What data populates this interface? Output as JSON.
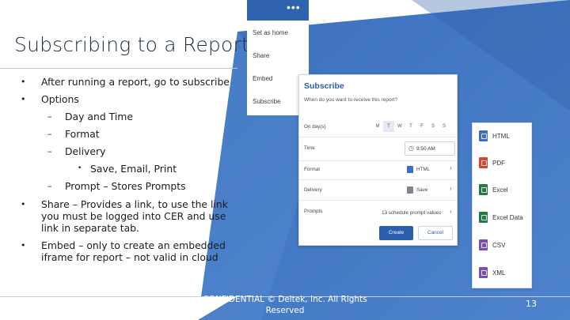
{
  "slide": {
    "title": "Subscribing to a Report",
    "bullets": [
      {
        "level": 1,
        "marker": "•",
        "text": "After running a report, go to subscribe"
      },
      {
        "level": 1,
        "marker": "•",
        "text": "Options"
      },
      {
        "level": 2,
        "marker": "–",
        "text": "Day and Time"
      },
      {
        "level": 2,
        "marker": "–",
        "text": "Format"
      },
      {
        "level": 2,
        "marker": "–",
        "text": "Delivery"
      },
      {
        "level": 3,
        "marker": "•",
        "text": "Save, Email, Print"
      },
      {
        "level": 2,
        "marker": "–",
        "text": "Prompt – Stores Prompts"
      },
      {
        "level": 1,
        "marker": "•",
        "text": "Share – Provides a link, to use the link you must be logged into CER and use link in separate tab."
      },
      {
        "level": 1,
        "marker": "•",
        "text": "Embed – only to create an embedded iframe for report – not valid in cloud"
      }
    ],
    "footer": "CONFIDENTIAL © Deltek, Inc. All Rights Reserved",
    "page_number": "13"
  },
  "menu": {
    "more_label": "•••",
    "items": [
      "Set as home",
      "Share",
      "Embed",
      "Subscribe"
    ]
  },
  "dialog": {
    "title": "Subscribe",
    "question": "When do you want to receive this report?",
    "labels": {
      "days": "On day(s)",
      "time": "Time",
      "format": "Format",
      "delivery": "Delivery",
      "prompts": "Prompts"
    },
    "days": [
      "M",
      "T",
      "W",
      "T",
      "F",
      "S",
      "S"
    ],
    "selected_day_index": 1,
    "time_value": "9:50 AM",
    "format_value": "HTML",
    "delivery_value": "Save",
    "prompts_value": "13 schedule prompt values",
    "create_label": "Create",
    "cancel_label": "Cancel"
  },
  "formats": [
    {
      "label": "HTML",
      "icon": "html-file-icon",
      "color": "#3b6fc4"
    },
    {
      "label": "PDF",
      "icon": "pdf-file-icon",
      "color": "#d9432f"
    },
    {
      "label": "Excel",
      "icon": "excel-file-icon",
      "color": "#1f7a45"
    },
    {
      "label": "Excel Data",
      "icon": "excel-data-file-icon",
      "color": "#1f7a45"
    },
    {
      "label": "CSV",
      "icon": "csv-file-icon",
      "color": "#7a4fb5"
    },
    {
      "label": "XML",
      "icon": "xml-file-icon",
      "color": "#7a4fb5"
    }
  ],
  "colors": {
    "accent": "#2b5fad",
    "background_blue": "#3f74c0"
  }
}
